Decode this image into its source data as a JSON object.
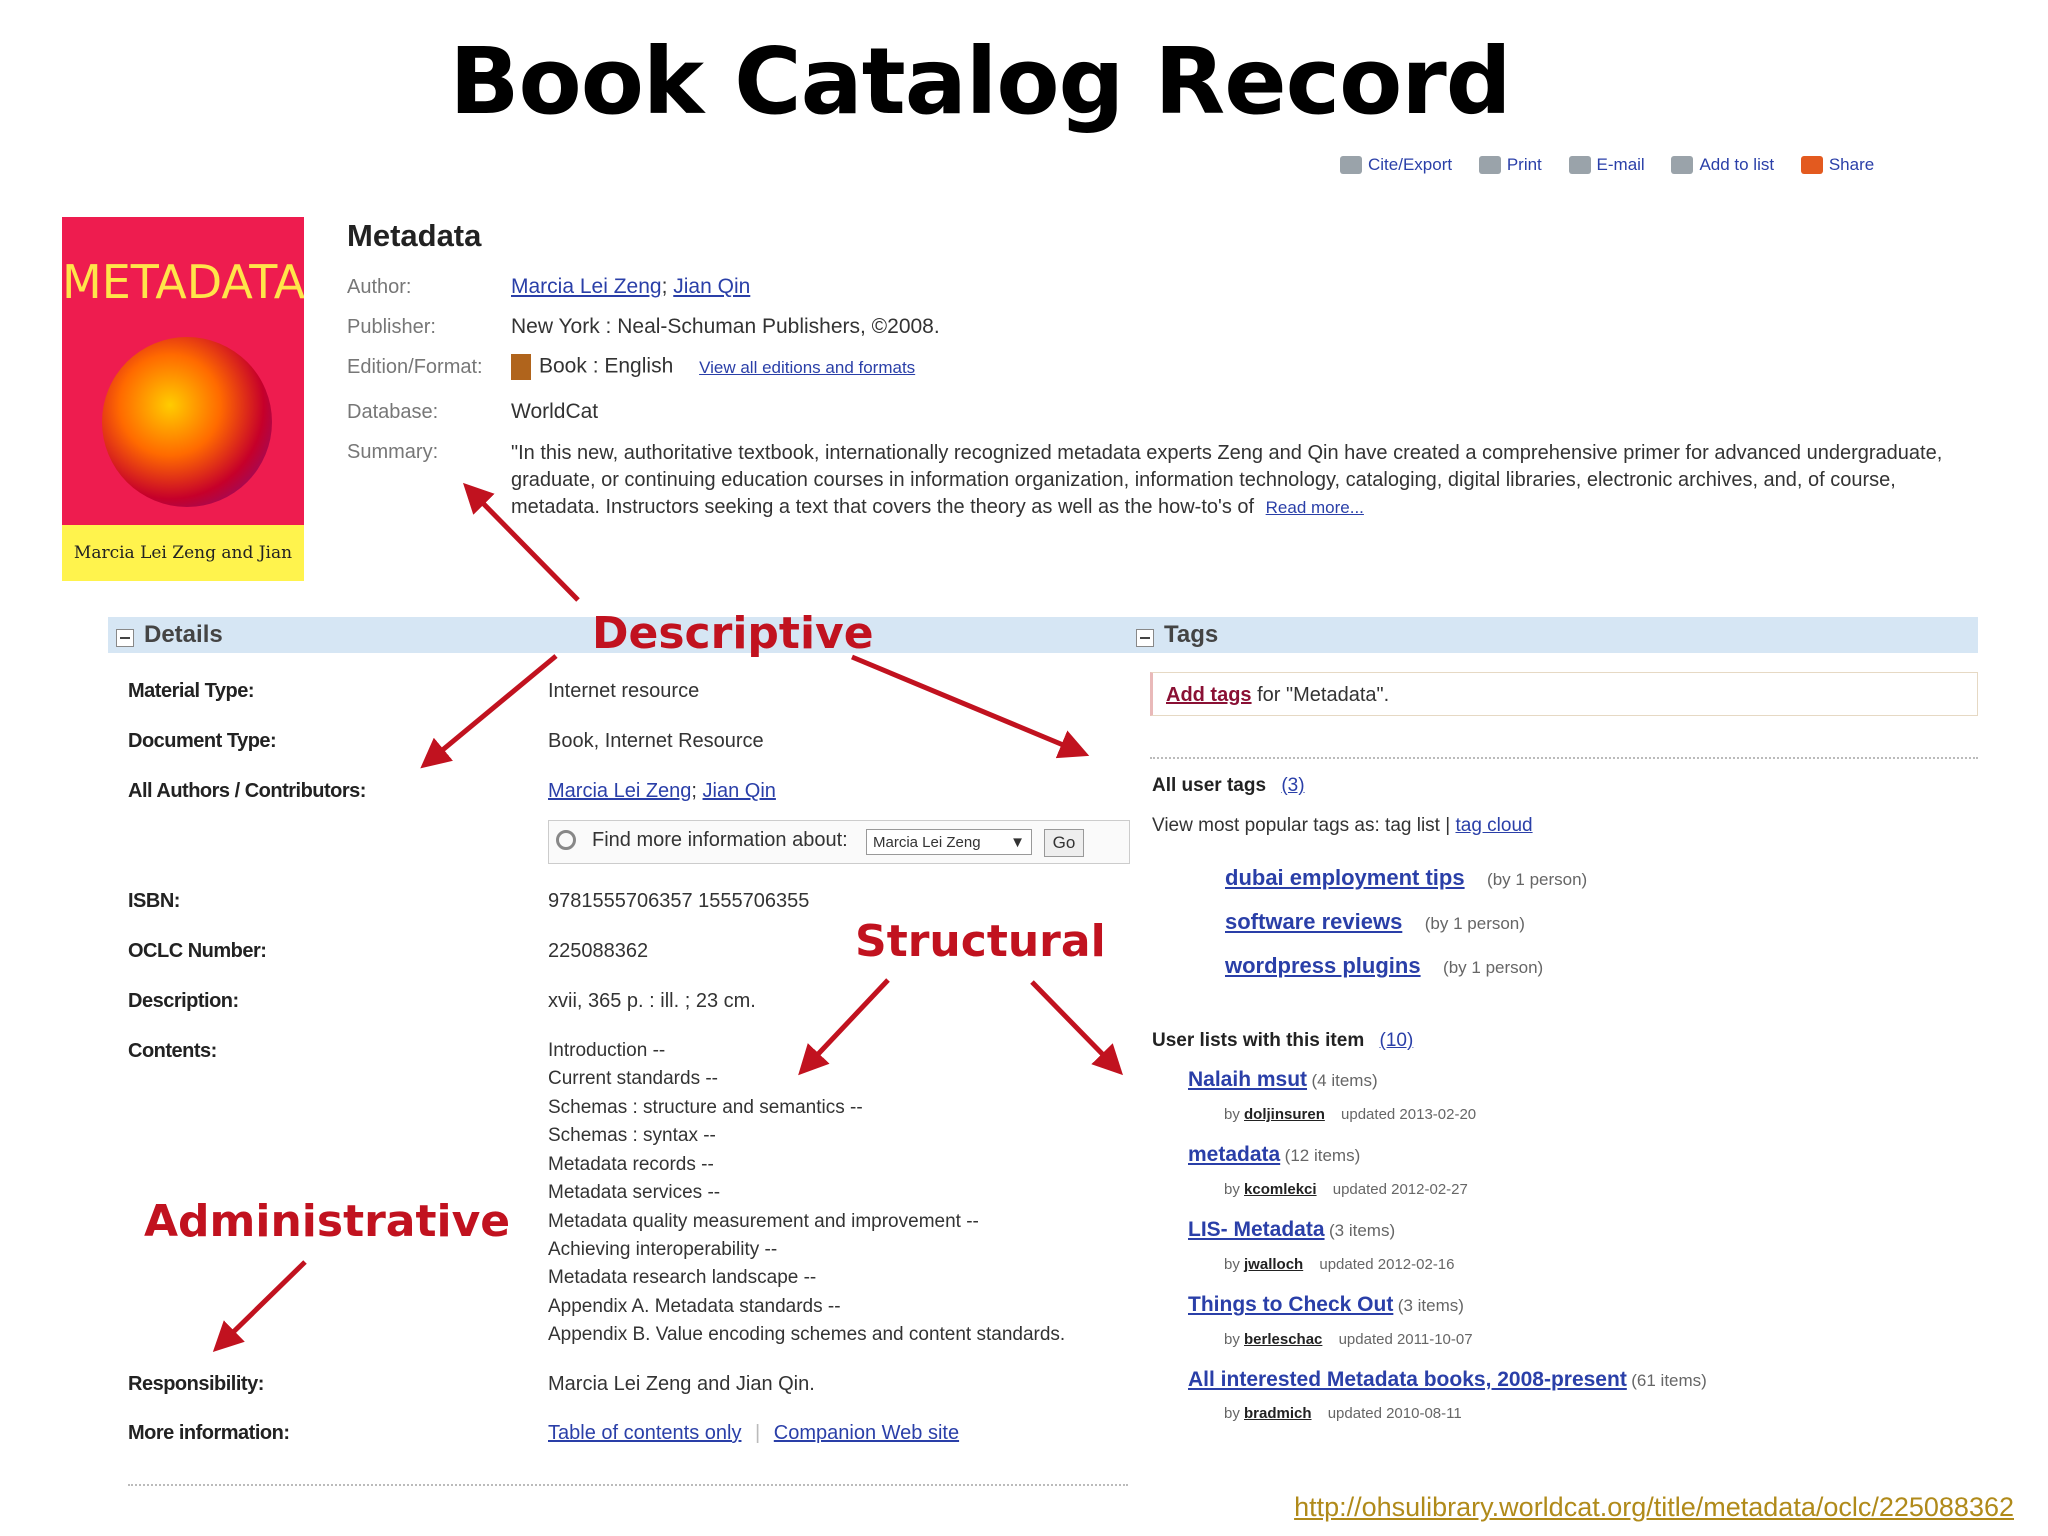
{
  "slide_title": "Book Catalog Record",
  "toolbar": [
    "Cite/Export",
    "Print",
    "E-mail",
    "Add to list",
    "Share"
  ],
  "cover": {
    "title": "METADATA",
    "authors": "Marcia Lei Zeng and Jian Qin"
  },
  "record": {
    "title": "Metadata",
    "labels": {
      "author": "Author:",
      "publisher": "Publisher:",
      "edition": "Edition/Format:",
      "database": "Database:",
      "summary": "Summary:"
    },
    "author1": "Marcia Lei Zeng",
    "author2": "Jian Qin",
    "publisher": "New York : Neal-Schuman Publishers, ©2008.",
    "format": "Book : English",
    "view_all": "View all editions and formats",
    "database": "WorldCat",
    "summary": "\"In this new, authoritative textbook, internationally recognized metadata experts Zeng and Qin have created a comprehensive primer for advanced undergraduate, graduate, or continuing education courses in information organization, information technology, cataloging, digital libraries, electronic archives, and, of course, metadata. Instructors seeking a text that covers the theory as well as the how-to's of",
    "read_more": "Read more..."
  },
  "details": {
    "header": "Details",
    "material_type_label": "Material Type:",
    "material_type": "Internet resource",
    "document_type_label": "Document Type:",
    "document_type": "Book, Internet Resource",
    "authors_label": "All Authors / Contributors:",
    "find_more": "Find more information about:",
    "find_select": "Marcia Lei Zeng",
    "go": "Go",
    "isbn_label": "ISBN:",
    "isbn": "9781555706357 1555706355",
    "oclc_label": "OCLC Number:",
    "oclc": "225088362",
    "description_label": "Description:",
    "description": "xvii, 365 p. : ill. ; 23 cm.",
    "contents_label": "Contents:",
    "contents": [
      "Introduction --",
      "Current standards --",
      "Schemas : structure and semantics --",
      "Schemas : syntax --",
      "Metadata records --",
      "Metadata services --",
      "Metadata quality measurement and improvement --",
      "Achieving interoperability --",
      "Metadata research landscape --",
      "Appendix A. Metadata standards --",
      "Appendix B. Value encoding schemes and content standards."
    ],
    "responsibility_label": "Responsibility:",
    "responsibility": "Marcia Lei Zeng and Jian Qin.",
    "more_info_label": "More information:",
    "toc": "Table of contents only",
    "companion": "Companion Web site"
  },
  "tags": {
    "header": "Tags",
    "add_tags": "Add tags",
    "add_tags_suffix": "for \"Metadata\".",
    "all_user_tags": "All user tags",
    "all_user_tags_count": "(3)",
    "view_popular": "View most popular tags as: tag list |",
    "tag_cloud": "tag cloud",
    "items": [
      {
        "name": "dubai employment tips",
        "by": "(by 1 person)"
      },
      {
        "name": "software reviews",
        "by": "(by 1 person)"
      },
      {
        "name": "wordpress plugins",
        "by": "(by 1 person)"
      }
    ],
    "user_lists_label": "User lists with this item",
    "user_lists_count": "(10)",
    "lists": [
      {
        "title": "Nalaih msut",
        "count": "(4 items)",
        "by": "by",
        "user": "doljinsuren",
        "updated": "updated 2013-02-20"
      },
      {
        "title": "metadata",
        "count": "(12 items)",
        "by": "by",
        "user": "kcomlekci",
        "updated": "updated 2012-02-27"
      },
      {
        "title": "LIS- Metadata",
        "count": "(3 items)",
        "by": "by",
        "user": "jwalloch",
        "updated": "updated 2012-02-16"
      },
      {
        "title": "Things to Check Out",
        "count": "(3 items)",
        "by": "by",
        "user": "berleschac",
        "updated": "updated 2011-10-07"
      },
      {
        "title": "All interested Metadata books, 2008-present",
        "count": "(61 items)",
        "by": "by",
        "user": "bradmich",
        "updated": "updated 2010-08-11"
      }
    ]
  },
  "annotations": {
    "descriptive": "Descriptive",
    "structural": "Structural",
    "administrative": "Administrative"
  },
  "url": "http://ohsulibrary.worldcat.org/title/metadata/oclc/225088362",
  "colors": {
    "annotation": "#c1121f",
    "link": "#2a3fa8",
    "bar": "#d6e6f4"
  }
}
